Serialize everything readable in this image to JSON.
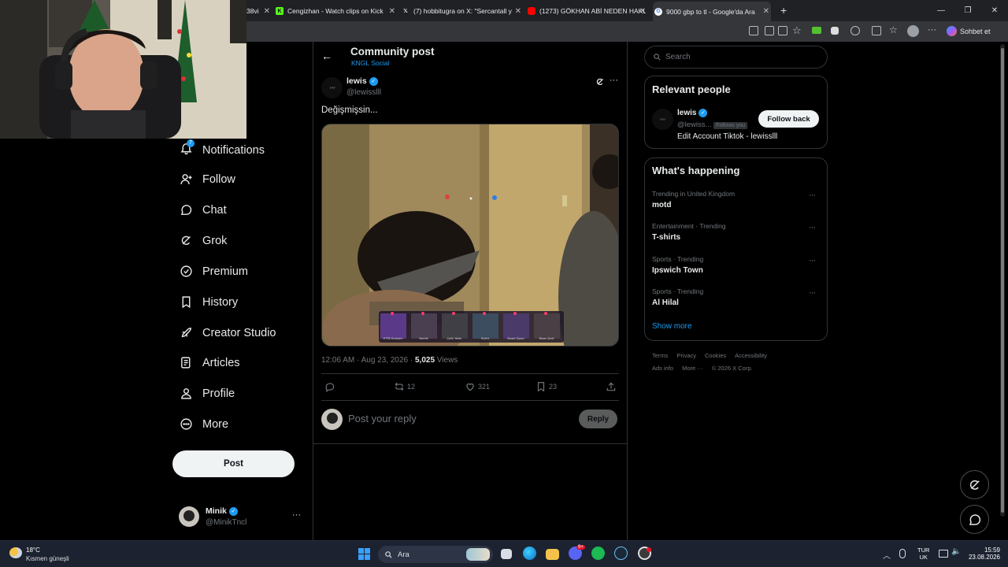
{
  "browser": {
    "tabs": [
      {
        "label": "38vi",
        "favicon": "tab-icon"
      },
      {
        "label": "Cengizhan - Watch clips on Kick",
        "favicon": "kick-icon",
        "color": "#53fc18"
      },
      {
        "label": "(7) hobbitugra on X: \"Sercantall y",
        "favicon": "x-icon",
        "color": "#ffffff"
      },
      {
        "label": "(1273) GÖKHAN ABİ NEDEN HAKL",
        "favicon": "youtube-icon",
        "color": "#ff0000"
      },
      {
        "label": "9000 gbp to tl - Google'da Ara",
        "favicon": "google-icon",
        "color": "#4285f4"
      }
    ],
    "new_tab": "+",
    "sohbet_label": "Sohbet et"
  },
  "nav": {
    "items": [
      {
        "label": "Notifications",
        "icon": "bell-icon",
        "badge": "7"
      },
      {
        "label": "Follow",
        "icon": "add-user-icon"
      },
      {
        "label": "Chat",
        "icon": "chat-icon"
      },
      {
        "label": "Grok",
        "icon": "grok-icon"
      },
      {
        "label": "Premium",
        "icon": "premium-icon"
      },
      {
        "label": "History",
        "icon": "bookmark-icon"
      },
      {
        "label": "Creator Studio",
        "icon": "rocket-icon"
      },
      {
        "label": "Articles",
        "icon": "article-icon"
      },
      {
        "label": "Profile",
        "icon": "person-icon"
      },
      {
        "label": "More",
        "icon": "more-circle-icon"
      }
    ],
    "post_label": "Post",
    "account": {
      "name": "Minik",
      "handle": "@MinikTncl"
    }
  },
  "post": {
    "header_title": "Community post",
    "header_subtitle": "KNGL Social",
    "author_name": "lewis",
    "author_handle": "@lewisslll",
    "text": "Değişmişsin...",
    "time": "12:06 AM · Aug 23, 2026 · ",
    "views_count": "5,025",
    "views_label": " Views",
    "reposts": "12",
    "likes": "321",
    "bookmarks": "23",
    "reply_placeholder": "Post your reply",
    "reply_button": "Reply",
    "media_hud_labels": [
      "HTTB Dumplin",
      "Nesilik",
      "Çelik Yelek",
      "Kiyfet",
      "Bissel Şişesi",
      "Bison Şerit"
    ]
  },
  "sidebar": {
    "search_placeholder": "Search",
    "relevant_title": "Relevant people",
    "person_name": "lewis",
    "person_handle": "@lewiss...",
    "follows_you": "Follows you",
    "follow_back": "Follow back",
    "person_bio": "Edit Account Tiktok - lewisslll",
    "happening_title": "What's happening",
    "trends": [
      {
        "category": "Trending in United Kingdom",
        "name": "motd"
      },
      {
        "category": "Entertainment · Trending",
        "name": "T-shirts"
      },
      {
        "category": "Sports · Trending",
        "name": "Ipswich Town"
      },
      {
        "category": "Sports · Trending",
        "name": "Al Hilal"
      }
    ],
    "show_more": "Show more",
    "footer_links_1": [
      "Terms",
      "Privacy",
      "Cookies",
      "Accessibility"
    ],
    "footer_links_2": [
      "Ads info",
      "More ···",
      "© 2026 X Corp."
    ]
  },
  "taskbar": {
    "weather_temp": "18°C",
    "weather_text": "Kısmen güneşli",
    "search_label": "Ara",
    "lang_1": "TUR",
    "lang_2": "UK",
    "time": "15:59",
    "date": "23.08.2026",
    "discord_badge": "9+"
  },
  "colors": {
    "accent": "#1d9bf0",
    "bg": "#000000",
    "border": "#2f3336",
    "muted": "#71767b"
  }
}
